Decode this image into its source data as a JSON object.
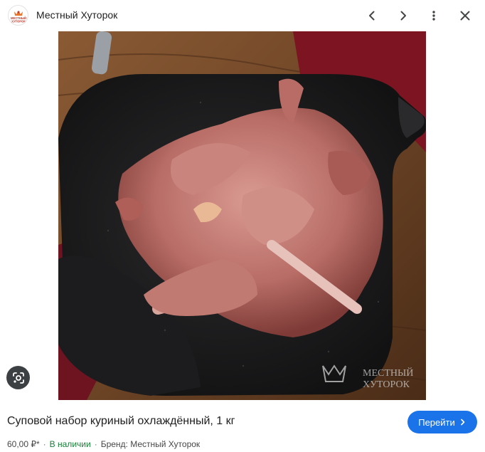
{
  "header": {
    "site_name": "Местный Хуторок",
    "favicon_text": "МЕСТНЫЙ ХУТОРОК",
    "icons": [
      "chevron-left-icon",
      "chevron-right-icon",
      "more-vert-icon",
      "close-icon"
    ]
  },
  "image": {
    "watermark_line1": "МЕСТНЫЙ",
    "watermark_line2": "ХУТОРОК",
    "lens_icon": "google-lens-icon"
  },
  "product": {
    "title": "Суповой набор куриный охлаждённый, 1 кг",
    "price": "60,00 ₽*",
    "availability": "В наличии",
    "brand": "Бренд: Местный Хуторок",
    "separator": "·"
  },
  "actions": {
    "visit_label": "Перейти",
    "accent": "#1a73e8"
  }
}
